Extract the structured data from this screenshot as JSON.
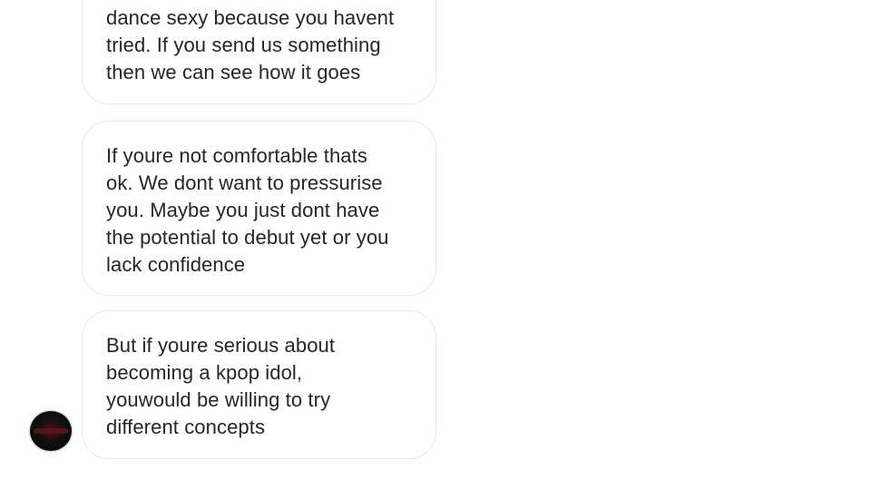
{
  "messages": [
    {
      "text": "dance sexy because you havent\ntried. If you send us something\nthen we can see how it goes"
    },
    {
      "text": "If youre not comfortable thats\nok. We dont want to pressurise\nyou. Maybe you just dont have\nthe potential to debut yet or you\nlack confidence"
    },
    {
      "text": "But if youre serious about\nbecoming a kpop idol,\nyouwould be willing to try\ndifferent concepts"
    }
  ],
  "sender": {
    "avatar_icon": "profile-avatar-icon"
  }
}
